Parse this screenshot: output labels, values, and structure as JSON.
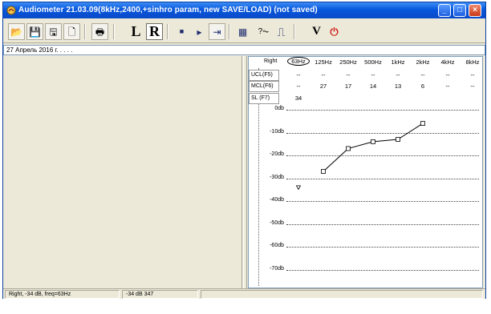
{
  "window": {
    "title": "Audiometer 21.03.09(8kHz,2400,+sinhro param, new SAVE/LOAD) (not saved)",
    "controls": [
      "_",
      "□",
      "×"
    ]
  },
  "toolbar": {
    "buttons": [
      {
        "name": "open",
        "icon": "folder-open-icon",
        "glyph": "📂"
      },
      {
        "name": "save",
        "icon": "floppy-save-icon",
        "glyph": "💾"
      },
      {
        "name": "save-all",
        "icon": "save-all-icon",
        "glyph": "🖫"
      },
      {
        "name": "new",
        "icon": "new-document-icon",
        "glyph": "🗋"
      },
      {
        "name": "print",
        "icon": "printer-icon",
        "glyph": "🖶"
      }
    ],
    "left_ear_label": "L",
    "right_ear_label": "R",
    "stop_glyph": "■",
    "play_glyph": "▸",
    "step_glyph": "⇥",
    "grid_glyph": "▦",
    "tone_glyph": "?⏦",
    "pulse_glyph": "⎍",
    "v_label": "V",
    "power_glyph": "⏻"
  },
  "date_text": "27 Апрель 2016 г. . . . .",
  "audiogram": {
    "ear_label": "Right",
    "frequencies": [
      "63Hz",
      "125Hz",
      "250Hz",
      "500Hz",
      "1kHz",
      "2kHz",
      "4kHz",
      "8kHz"
    ],
    "selected_frequency": "63Hz",
    "rows": [
      {
        "label": "UCL(F5)",
        "values": [
          "--",
          "--",
          "--",
          "--",
          "--",
          "--",
          "--",
          "--"
        ]
      },
      {
        "label": "MCL(F6)",
        "values": [
          "--",
          "27",
          "17",
          "14",
          "13",
          "6",
          "--",
          "--"
        ]
      },
      {
        "label": "SL (F7)",
        "values": [
          "34",
          "",
          "",
          "",
          "",
          "",
          "",
          ""
        ]
      }
    ],
    "db_levels": [
      "0db",
      "-10db",
      "-20db",
      "-30db",
      "-40db",
      "-50db",
      "-60db",
      "-70db"
    ]
  },
  "chart_data": {
    "type": "line",
    "categories": [
      "63Hz",
      "125Hz",
      "250Hz",
      "500Hz",
      "1kHz",
      "2kHz",
      "4kHz",
      "8kHz"
    ],
    "series": [
      {
        "values": [
          null,
          -27,
          -17,
          -14,
          -13,
          -6,
          null,
          null
        ],
        "color": "#000000",
        "marker": "square"
      }
    ],
    "extra_points": [
      {
        "category": "63Hz",
        "value": -34,
        "marker": "triangle-down"
      }
    ],
    "ylim": [
      0,
      -70
    ],
    "yticks": [
      "0db",
      "-10db",
      "-20db",
      "-30db",
      "-40db",
      "-50db",
      "-60db",
      "-70db"
    ],
    "grid": true
  },
  "status": {
    "left": "Right, -34 dB, freq=63Hz",
    "mid": "-34 dB  347",
    "right": ""
  }
}
